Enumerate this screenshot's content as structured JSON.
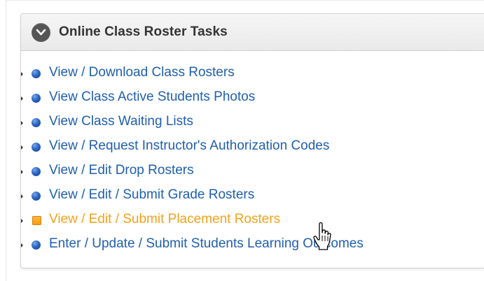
{
  "panel": {
    "title": "Online Class Roster Tasks",
    "collapse_icon": "chevron-down-icon"
  },
  "tasks": [
    {
      "label": "View / Download Class Rosters",
      "icon": "blue-bullet-icon",
      "state": "normal"
    },
    {
      "label": "View Class Active Students Photos",
      "icon": "blue-bullet-icon",
      "state": "normal"
    },
    {
      "label": "View Class Waiting Lists",
      "icon": "blue-bullet-icon",
      "state": "normal"
    },
    {
      "label": "View / Request Instructor's Authorization Codes",
      "icon": "blue-bullet-icon",
      "state": "normal"
    },
    {
      "label": "View / Edit Drop Rosters",
      "icon": "blue-bullet-icon",
      "state": "normal"
    },
    {
      "label": "View / Edit / Submit Grade Rosters",
      "icon": "blue-bullet-icon",
      "state": "normal"
    },
    {
      "label": "View / Edit / Submit Placement Rosters",
      "icon": "orange-square-icon",
      "state": "hover"
    },
    {
      "label": "Enter / Update / Submit Students Learning Outcomes",
      "icon": "blue-bullet-icon",
      "state": "normal"
    }
  ],
  "colors": {
    "link": "#1f5fae",
    "link_hover": "#f2a31c",
    "header_bg": "#efefef"
  },
  "cursor": "hand-pointer-icon"
}
